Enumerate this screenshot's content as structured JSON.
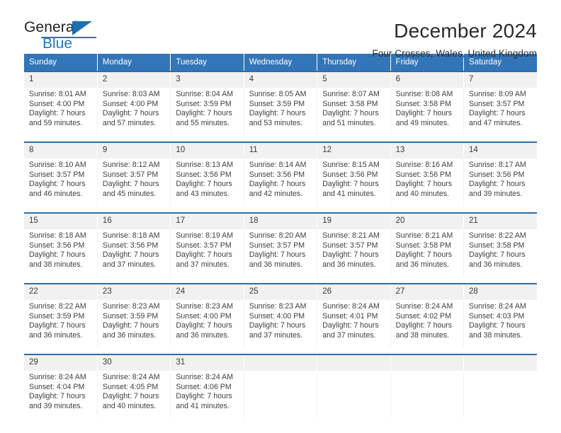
{
  "brand": {
    "name_part1": "General",
    "name_part2": "Blue",
    "logo_icon": "triangle-logo-icon",
    "accent_color": "#1f78c1"
  },
  "header": {
    "title": "December 2024",
    "subtitle": "Four Crosses, Wales, United Kingdom"
  },
  "calendar": {
    "header_bg": "#3275b8",
    "daynum_bg": "#f1f1f1",
    "weekday_headers": [
      "Sunday",
      "Monday",
      "Tuesday",
      "Wednesday",
      "Thursday",
      "Friday",
      "Saturday"
    ],
    "weeks": [
      [
        {
          "day": "1",
          "sunrise": "Sunrise: 8:01 AM",
          "sunset": "Sunset: 4:00 PM",
          "daylight_line1": "Daylight: 7 hours",
          "daylight_line2": "and 59 minutes."
        },
        {
          "day": "2",
          "sunrise": "Sunrise: 8:03 AM",
          "sunset": "Sunset: 4:00 PM",
          "daylight_line1": "Daylight: 7 hours",
          "daylight_line2": "and 57 minutes."
        },
        {
          "day": "3",
          "sunrise": "Sunrise: 8:04 AM",
          "sunset": "Sunset: 3:59 PM",
          "daylight_line1": "Daylight: 7 hours",
          "daylight_line2": "and 55 minutes."
        },
        {
          "day": "4",
          "sunrise": "Sunrise: 8:05 AM",
          "sunset": "Sunset: 3:59 PM",
          "daylight_line1": "Daylight: 7 hours",
          "daylight_line2": "and 53 minutes."
        },
        {
          "day": "5",
          "sunrise": "Sunrise: 8:07 AM",
          "sunset": "Sunset: 3:58 PM",
          "daylight_line1": "Daylight: 7 hours",
          "daylight_line2": "and 51 minutes."
        },
        {
          "day": "6",
          "sunrise": "Sunrise: 8:08 AM",
          "sunset": "Sunset: 3:58 PM",
          "daylight_line1": "Daylight: 7 hours",
          "daylight_line2": "and 49 minutes."
        },
        {
          "day": "7",
          "sunrise": "Sunrise: 8:09 AM",
          "sunset": "Sunset: 3:57 PM",
          "daylight_line1": "Daylight: 7 hours",
          "daylight_line2": "and 47 minutes."
        }
      ],
      [
        {
          "day": "8",
          "sunrise": "Sunrise: 8:10 AM",
          "sunset": "Sunset: 3:57 PM",
          "daylight_line1": "Daylight: 7 hours",
          "daylight_line2": "and 46 minutes."
        },
        {
          "day": "9",
          "sunrise": "Sunrise: 8:12 AM",
          "sunset": "Sunset: 3:57 PM",
          "daylight_line1": "Daylight: 7 hours",
          "daylight_line2": "and 45 minutes."
        },
        {
          "day": "10",
          "sunrise": "Sunrise: 8:13 AM",
          "sunset": "Sunset: 3:56 PM",
          "daylight_line1": "Daylight: 7 hours",
          "daylight_line2": "and 43 minutes."
        },
        {
          "day": "11",
          "sunrise": "Sunrise: 8:14 AM",
          "sunset": "Sunset: 3:56 PM",
          "daylight_line1": "Daylight: 7 hours",
          "daylight_line2": "and 42 minutes."
        },
        {
          "day": "12",
          "sunrise": "Sunrise: 8:15 AM",
          "sunset": "Sunset: 3:56 PM",
          "daylight_line1": "Daylight: 7 hours",
          "daylight_line2": "and 41 minutes."
        },
        {
          "day": "13",
          "sunrise": "Sunrise: 8:16 AM",
          "sunset": "Sunset: 3:56 PM",
          "daylight_line1": "Daylight: 7 hours",
          "daylight_line2": "and 40 minutes."
        },
        {
          "day": "14",
          "sunrise": "Sunrise: 8:17 AM",
          "sunset": "Sunset: 3:56 PM",
          "daylight_line1": "Daylight: 7 hours",
          "daylight_line2": "and 39 minutes."
        }
      ],
      [
        {
          "day": "15",
          "sunrise": "Sunrise: 8:18 AM",
          "sunset": "Sunset: 3:56 PM",
          "daylight_line1": "Daylight: 7 hours",
          "daylight_line2": "and 38 minutes."
        },
        {
          "day": "16",
          "sunrise": "Sunrise: 8:18 AM",
          "sunset": "Sunset: 3:56 PM",
          "daylight_line1": "Daylight: 7 hours",
          "daylight_line2": "and 37 minutes."
        },
        {
          "day": "17",
          "sunrise": "Sunrise: 8:19 AM",
          "sunset": "Sunset: 3:57 PM",
          "daylight_line1": "Daylight: 7 hours",
          "daylight_line2": "and 37 minutes."
        },
        {
          "day": "18",
          "sunrise": "Sunrise: 8:20 AM",
          "sunset": "Sunset: 3:57 PM",
          "daylight_line1": "Daylight: 7 hours",
          "daylight_line2": "and 36 minutes."
        },
        {
          "day": "19",
          "sunrise": "Sunrise: 8:21 AM",
          "sunset": "Sunset: 3:57 PM",
          "daylight_line1": "Daylight: 7 hours",
          "daylight_line2": "and 36 minutes."
        },
        {
          "day": "20",
          "sunrise": "Sunrise: 8:21 AM",
          "sunset": "Sunset: 3:58 PM",
          "daylight_line1": "Daylight: 7 hours",
          "daylight_line2": "and 36 minutes."
        },
        {
          "day": "21",
          "sunrise": "Sunrise: 8:22 AM",
          "sunset": "Sunset: 3:58 PM",
          "daylight_line1": "Daylight: 7 hours",
          "daylight_line2": "and 36 minutes."
        }
      ],
      [
        {
          "day": "22",
          "sunrise": "Sunrise: 8:22 AM",
          "sunset": "Sunset: 3:59 PM",
          "daylight_line1": "Daylight: 7 hours",
          "daylight_line2": "and 36 minutes."
        },
        {
          "day": "23",
          "sunrise": "Sunrise: 8:23 AM",
          "sunset": "Sunset: 3:59 PM",
          "daylight_line1": "Daylight: 7 hours",
          "daylight_line2": "and 36 minutes."
        },
        {
          "day": "24",
          "sunrise": "Sunrise: 8:23 AM",
          "sunset": "Sunset: 4:00 PM",
          "daylight_line1": "Daylight: 7 hours",
          "daylight_line2": "and 36 minutes."
        },
        {
          "day": "25",
          "sunrise": "Sunrise: 8:23 AM",
          "sunset": "Sunset: 4:00 PM",
          "daylight_line1": "Daylight: 7 hours",
          "daylight_line2": "and 37 minutes."
        },
        {
          "day": "26",
          "sunrise": "Sunrise: 8:24 AM",
          "sunset": "Sunset: 4:01 PM",
          "daylight_line1": "Daylight: 7 hours",
          "daylight_line2": "and 37 minutes."
        },
        {
          "day": "27",
          "sunrise": "Sunrise: 8:24 AM",
          "sunset": "Sunset: 4:02 PM",
          "daylight_line1": "Daylight: 7 hours",
          "daylight_line2": "and 38 minutes."
        },
        {
          "day": "28",
          "sunrise": "Sunrise: 8:24 AM",
          "sunset": "Sunset: 4:03 PM",
          "daylight_line1": "Daylight: 7 hours",
          "daylight_line2": "and 38 minutes."
        }
      ],
      [
        {
          "day": "29",
          "sunrise": "Sunrise: 8:24 AM",
          "sunset": "Sunset: 4:04 PM",
          "daylight_line1": "Daylight: 7 hours",
          "daylight_line2": "and 39 minutes."
        },
        {
          "day": "30",
          "sunrise": "Sunrise: 8:24 AM",
          "sunset": "Sunset: 4:05 PM",
          "daylight_line1": "Daylight: 7 hours",
          "daylight_line2": "and 40 minutes."
        },
        {
          "day": "31",
          "sunrise": "Sunrise: 8:24 AM",
          "sunset": "Sunset: 4:06 PM",
          "daylight_line1": "Daylight: 7 hours",
          "daylight_line2": "and 41 minutes."
        },
        {
          "day": "",
          "sunrise": "",
          "sunset": "",
          "daylight_line1": "",
          "daylight_line2": ""
        },
        {
          "day": "",
          "sunrise": "",
          "sunset": "",
          "daylight_line1": "",
          "daylight_line2": ""
        },
        {
          "day": "",
          "sunrise": "",
          "sunset": "",
          "daylight_line1": "",
          "daylight_line2": ""
        },
        {
          "day": "",
          "sunrise": "",
          "sunset": "",
          "daylight_line1": "",
          "daylight_line2": ""
        }
      ]
    ]
  }
}
